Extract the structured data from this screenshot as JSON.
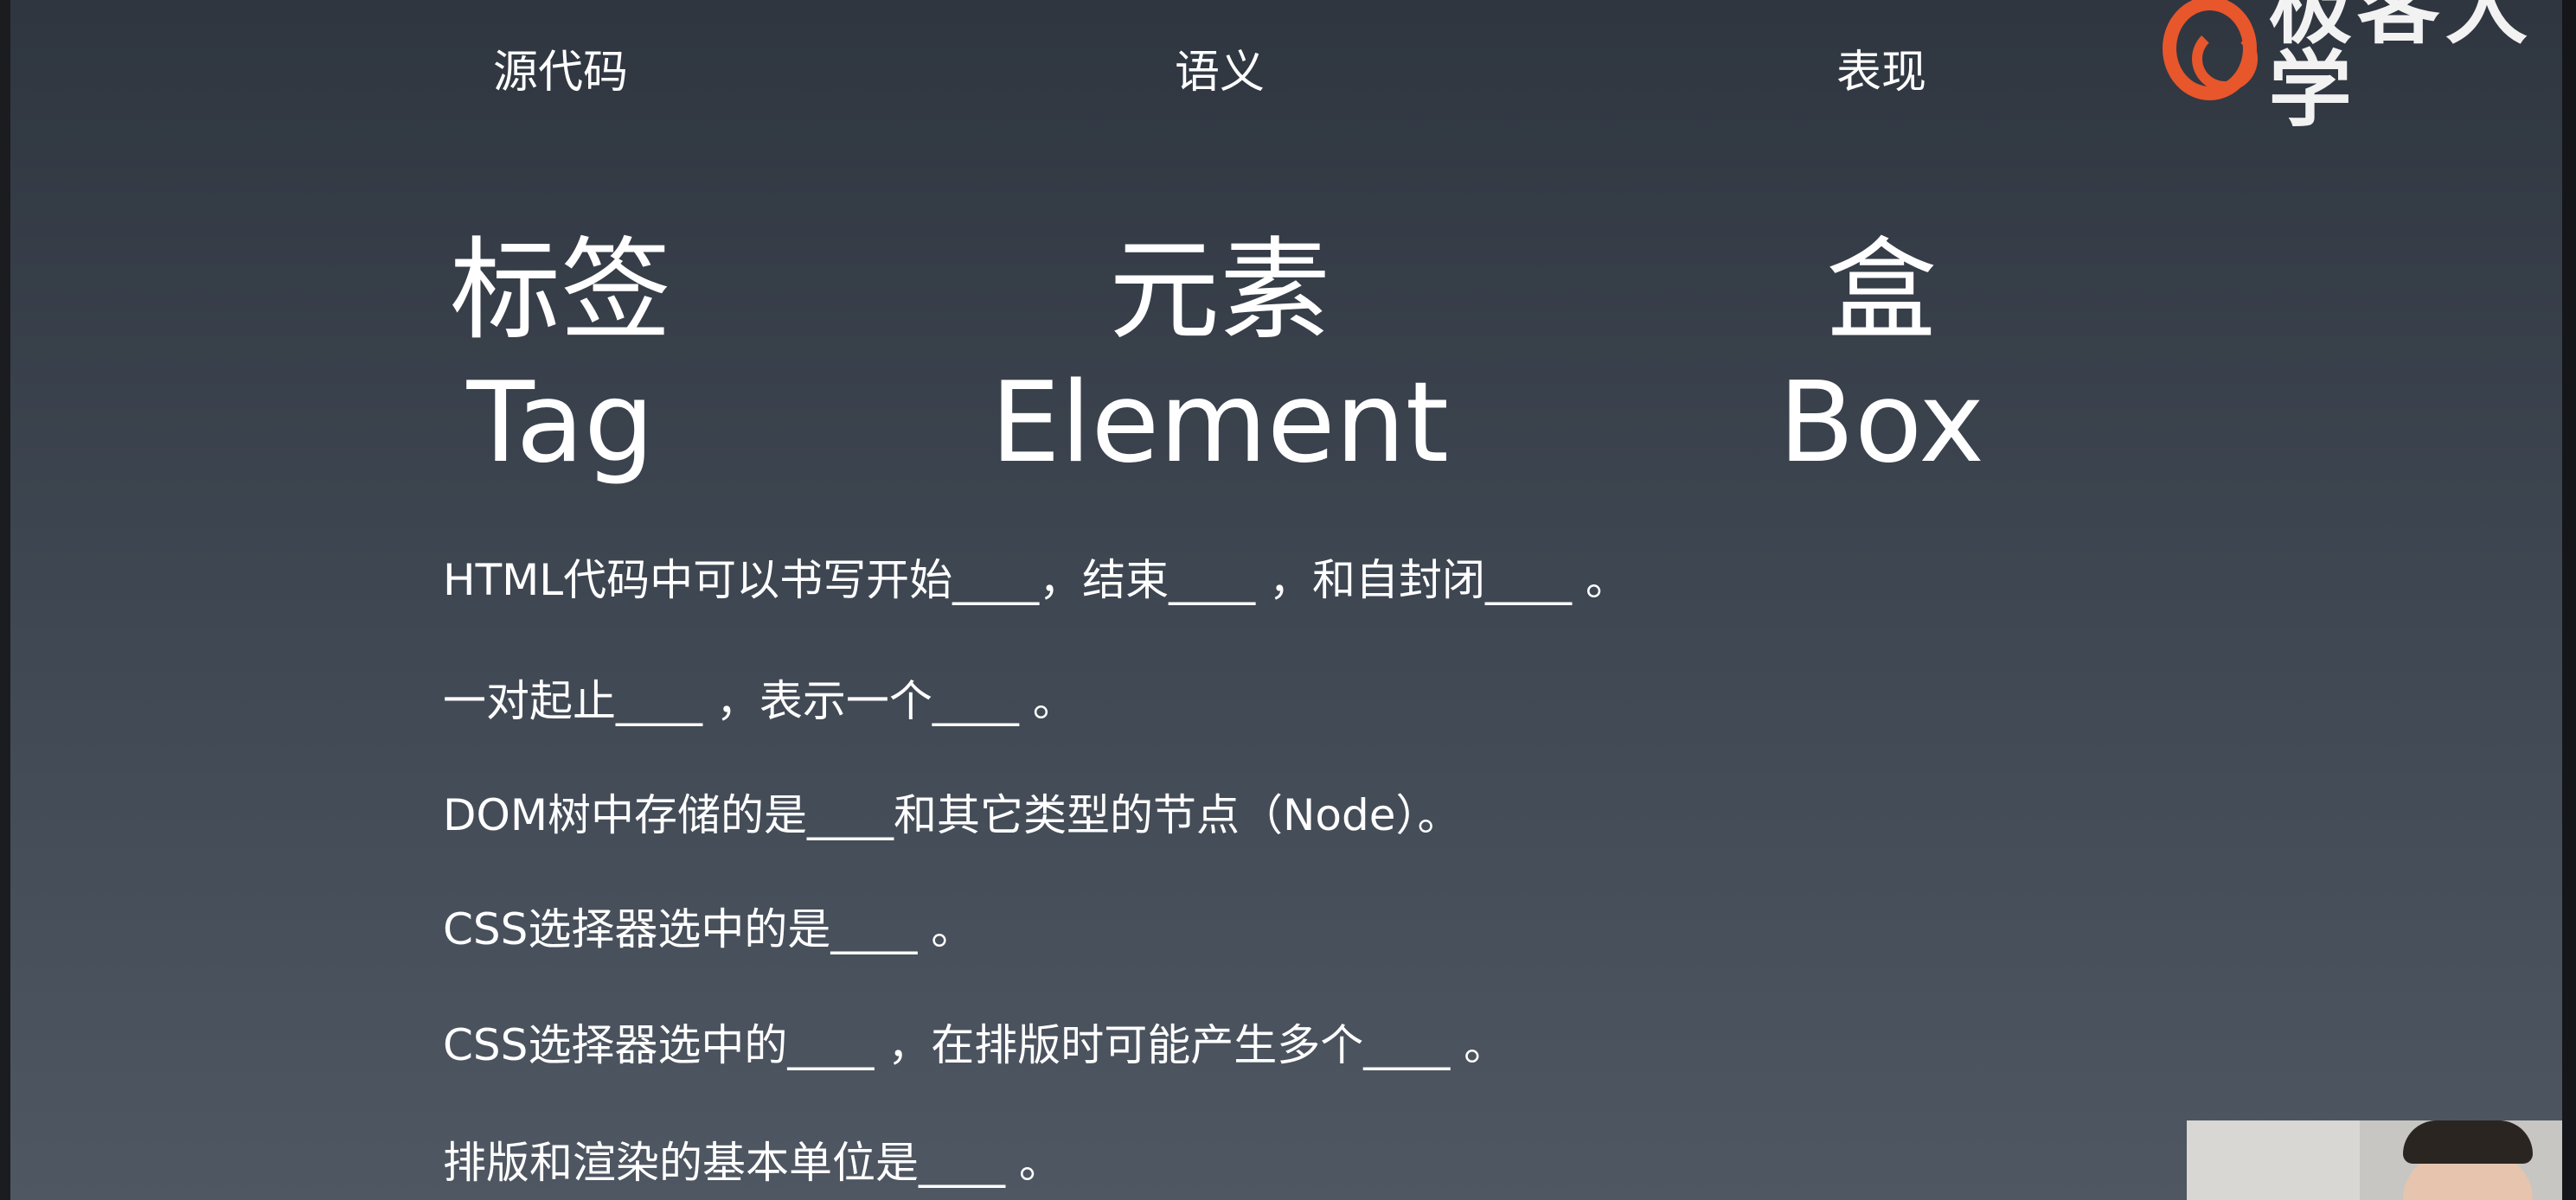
{
  "logo": {
    "text": "极客大学",
    "accent_color": "#e8562c"
  },
  "columns": [
    {
      "small": "源代码",
      "big": "标签",
      "english": "Tag"
    },
    {
      "small": "语义",
      "big": "元素",
      "english": "Element"
    },
    {
      "small": "表现",
      "big": "盒",
      "english": "Box"
    }
  ],
  "questions": [
    "HTML代码中可以书写开始____，结束____ ，和自封闭____ 。",
    "一对起止____ ，表示一个____ 。",
    "DOM树中存储的是____和其它类型的节点（Node）。",
    "CSS选择器选中的是____ 。",
    "CSS选择器选中的____ ，在排版时可能产生多个____ 。",
    "排版和渲染的基本单位是____ 。"
  ],
  "webcam": {
    "icon": "presenter-video"
  }
}
